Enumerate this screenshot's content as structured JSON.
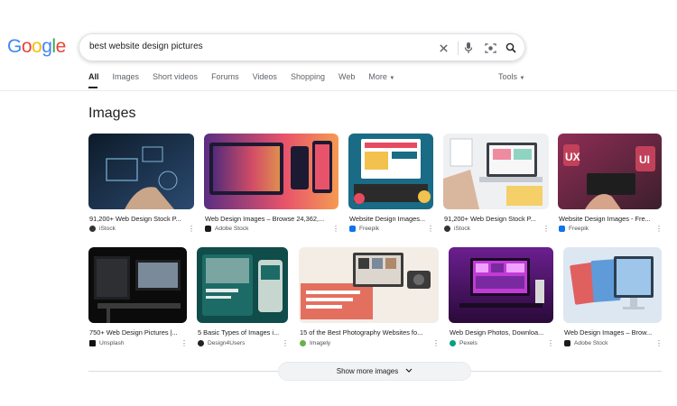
{
  "logo": [
    "G",
    "o",
    "o",
    "g",
    "l",
    "e"
  ],
  "logo_colors": [
    "#4285F4",
    "#EA4335",
    "#FBBC05",
    "#4285F4",
    "#34A853",
    "#EA4335"
  ],
  "search": {
    "query": "best website design pictures"
  },
  "tabs": [
    {
      "label": "All",
      "active": true
    },
    {
      "label": "Images"
    },
    {
      "label": "Short videos"
    },
    {
      "label": "Forums"
    },
    {
      "label": "Videos"
    },
    {
      "label": "Shopping"
    },
    {
      "label": "Web"
    },
    {
      "label": "More"
    }
  ],
  "tools_label": "Tools",
  "section_title": "Images",
  "results": [
    {
      "caption": "91,200+ Web Design Stock P...",
      "source": "iStock",
      "favicon_color": "#333333",
      "colors": [
        "#0d1b2a",
        "#2b4a6f",
        "#7fb3d5"
      ]
    },
    {
      "caption": "Web Design Images – Browse 24,362,...",
      "source": "Adobe Stock",
      "favicon_color": "#1b1b1b",
      "colors": [
        "#5a2d82",
        "#e8536b",
        "#f59a52"
      ]
    },
    {
      "caption": "Website Design Images...",
      "source": "Freepik",
      "favicon_color": "#1273eb",
      "colors": [
        "#1a6b85",
        "#f2c14e",
        "#e84a5f"
      ]
    },
    {
      "caption": "91,200+ Web Design Stock P...",
      "source": "iStock",
      "favicon_color": "#333333",
      "colors": [
        "#e9ecef",
        "#c7cbd1",
        "#7d8a96"
      ]
    },
    {
      "caption": "Website Design Images - Fre...",
      "source": "Freepik",
      "favicon_color": "#1273eb",
      "colors": [
        "#3b1f2b",
        "#c2415a",
        "#8f2d56"
      ]
    },
    {
      "caption": "750+ Web Design Pictures |...",
      "source": "Unsplash",
      "favicon_color": "#111111",
      "colors": [
        "#0b0b0b",
        "#2d2f33",
        "#7a8a9a"
      ]
    },
    {
      "caption": "5 Basic Types of Images i...",
      "source": "Design4Users",
      "favicon_color": "#222222",
      "colors": [
        "#0f4c4a",
        "#1d6b66",
        "#c8d6d0"
      ]
    },
    {
      "caption": "15 of the Best Photography Websites fo...",
      "source": "Imagely",
      "favicon_color": "#6ab04c",
      "colors": [
        "#f3ede6",
        "#e36f5f",
        "#3b3b3b"
      ]
    },
    {
      "caption": "Web Design Photos, Downloa...",
      "source": "Pexels",
      "favicon_color": "#05a081",
      "colors": [
        "#2a0a3a",
        "#c13bd6",
        "#6b1f8f"
      ]
    },
    {
      "caption": "Web Design Images – Brow...",
      "source": "Adobe Stock",
      "favicon_color": "#1b1b1b",
      "colors": [
        "#dde7f2",
        "#5f9bd8",
        "#e0605f"
      ]
    }
  ],
  "show_more_label": "Show more images"
}
